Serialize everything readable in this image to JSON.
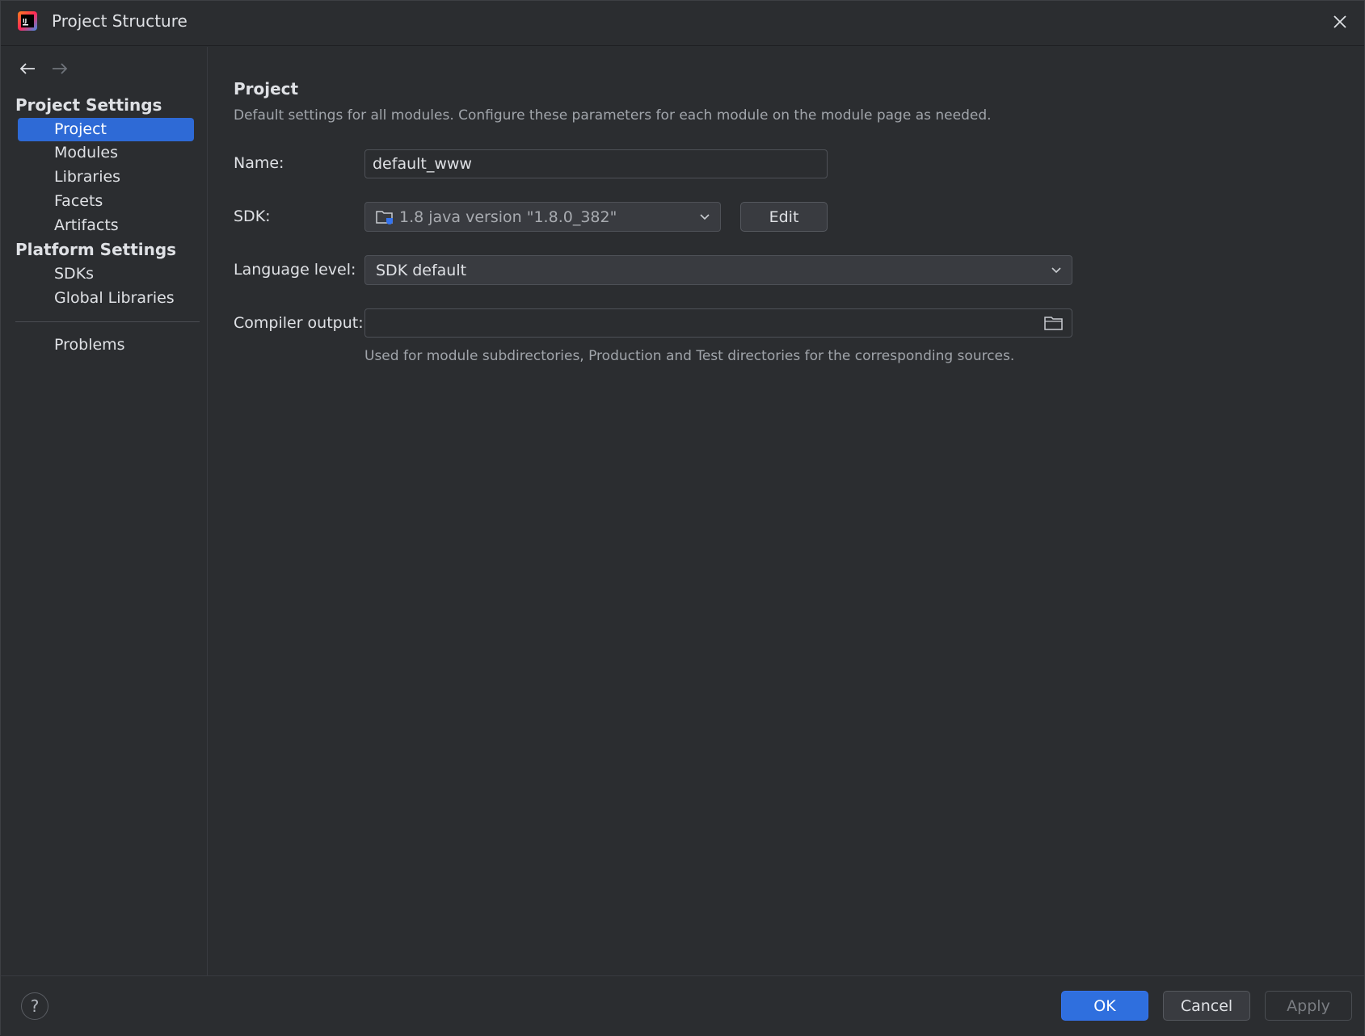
{
  "window": {
    "title": "Project Structure",
    "logo_text": "IJ"
  },
  "colors": {
    "selection": "#2e6ad6",
    "primary_button": "#2f6fde",
    "background": "#2b2d30",
    "muted_text": "#a1a5ab"
  },
  "icons": {
    "app": "intellij-logo-icon",
    "close": "close-icon",
    "back": "arrow-left-icon",
    "forward": "arrow-right-icon",
    "sdk": "folder-sdk-icon",
    "browse": "folder-icon",
    "dropdown": "chevron-down-icon",
    "help": "help-icon"
  },
  "sidebar": {
    "project_settings_header": "Project Settings",
    "project_items": [
      {
        "label": "Project",
        "selected": true
      },
      {
        "label": "Modules",
        "selected": false
      },
      {
        "label": "Libraries",
        "selected": false
      },
      {
        "label": "Facets",
        "selected": false
      },
      {
        "label": "Artifacts",
        "selected": false
      }
    ],
    "platform_settings_header": "Platform Settings",
    "platform_items": [
      {
        "label": "SDKs"
      },
      {
        "label": "Global Libraries"
      }
    ],
    "problems_label": "Problems"
  },
  "main": {
    "title": "Project",
    "description": "Default settings for all modules. Configure these parameters for each module on the module page as needed.",
    "name_label": "Name:",
    "name_value": "default_www",
    "sdk_label": "SDK:",
    "sdk_value": "1.8 java version \"1.8.0_382\"",
    "edit_label": "Edit",
    "language_level_label": "Language level:",
    "language_level_value": "SDK default",
    "compiler_output_label": "Compiler output:",
    "compiler_output_value": "",
    "compiler_output_hint": "Used for module subdirectories, Production and Test directories for the corresponding sources."
  },
  "footer": {
    "help_label": "?",
    "ok_label": "OK",
    "cancel_label": "Cancel",
    "apply_label": "Apply"
  }
}
